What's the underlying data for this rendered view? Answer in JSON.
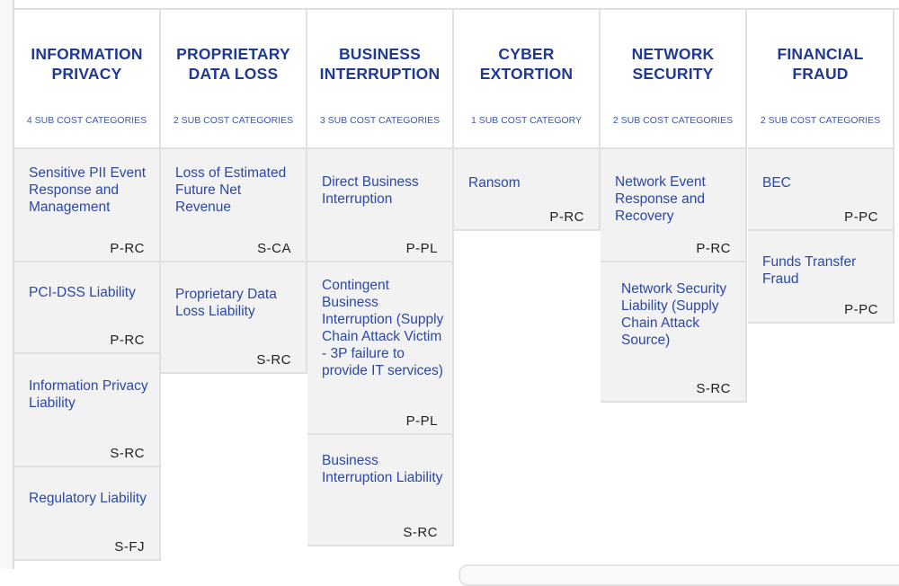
{
  "columns": [
    {
      "title": "INFORMATION PRIVACY",
      "subtitle": "4 SUB COST CATEGORIES",
      "items": [
        {
          "label": "Sensitive PII Event Response and Management",
          "code": "P-RC"
        },
        {
          "label": "PCI-DSS Liability",
          "code": "P-RC"
        },
        {
          "label": "Information Privacy Liability",
          "code": "S-RC"
        },
        {
          "label": "Regulatory Liability",
          "code": "S-FJ"
        }
      ]
    },
    {
      "title": "PROPRIETARY DATA LOSS",
      "subtitle": "2 SUB COST CATEGORIES",
      "items": [
        {
          "label": "Loss of Estimated Future Net Revenue",
          "code": "S-CA"
        },
        {
          "label": "Proprietary Data Loss Liability",
          "code": "S-RC"
        }
      ]
    },
    {
      "title": "BUSINESS INTERRUPTION",
      "subtitle": "3 SUB COST CATEGORIES",
      "items": [
        {
          "label": "Direct Business Interruption",
          "code": "P-PL"
        },
        {
          "label": "Contingent Business Interruption (Supply Chain Attack Victim - 3P failure to provide IT services)",
          "code": "P-PL"
        },
        {
          "label": "Business Interruption Liability",
          "code": "S-RC"
        }
      ]
    },
    {
      "title": "CYBER EXTORTION",
      "subtitle": "1 SUB COST CATEGORY",
      "items": [
        {
          "label": "Ransom",
          "code": "P-RC"
        }
      ]
    },
    {
      "title": "NETWORK SECURITY",
      "subtitle": "2 SUB COST CATEGORIES",
      "items": [
        {
          "label": "Network Event Response and Recovery",
          "code": "P-RC"
        },
        {
          "label": "Network Security Liability (Supply Chain Attack Source)",
          "code": "S-RC"
        }
      ]
    },
    {
      "title": "FINANCIAL FRAUD",
      "subtitle": "2 SUB COST CATEGORIES",
      "items": [
        {
          "label": "BEC",
          "code": "P-PC"
        },
        {
          "label": "Funds Transfer Fraud",
          "code": "P-PC"
        }
      ]
    }
  ]
}
